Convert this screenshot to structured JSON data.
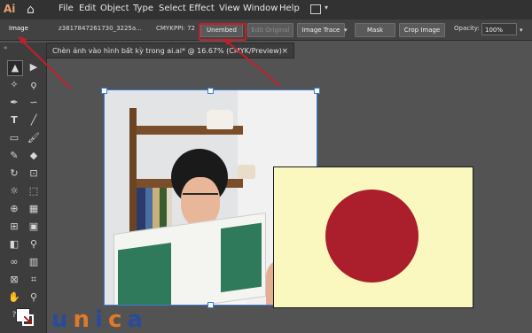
{
  "menubar": {
    "logo": "Ai",
    "items": [
      "File",
      "Edit",
      "Object",
      "Type",
      "Select",
      "Effect",
      "View",
      "Window",
      "Help"
    ]
  },
  "control_bar": {
    "image_label": "Image",
    "filename": "z3817847261730_3225a...",
    "color_mode": "CMYK",
    "ppi": "PPI: 72",
    "unembed": "Unembed",
    "edit_original": "Edit Original",
    "image_trace": "Image Trace",
    "mask": "Mask",
    "crop_image": "Crop Image",
    "opacity_label": "Opacity:",
    "opacity_value": "100%"
  },
  "document_tab": {
    "title": "Chèn ảnh vào hình bất kỳ trong ai.ai* @ 16.67% (CMYK/Preview)",
    "close": "×"
  },
  "watermark": {
    "text": "unica",
    "colors": [
      "#2a4a9c",
      "#e07a2a",
      "#2a4a9c",
      "#e07a2a",
      "#2a4a9c"
    ]
  },
  "colors": {
    "highlight": "#c0202a",
    "circle": "#ab1e2c",
    "box": "#fbf8bf"
  }
}
